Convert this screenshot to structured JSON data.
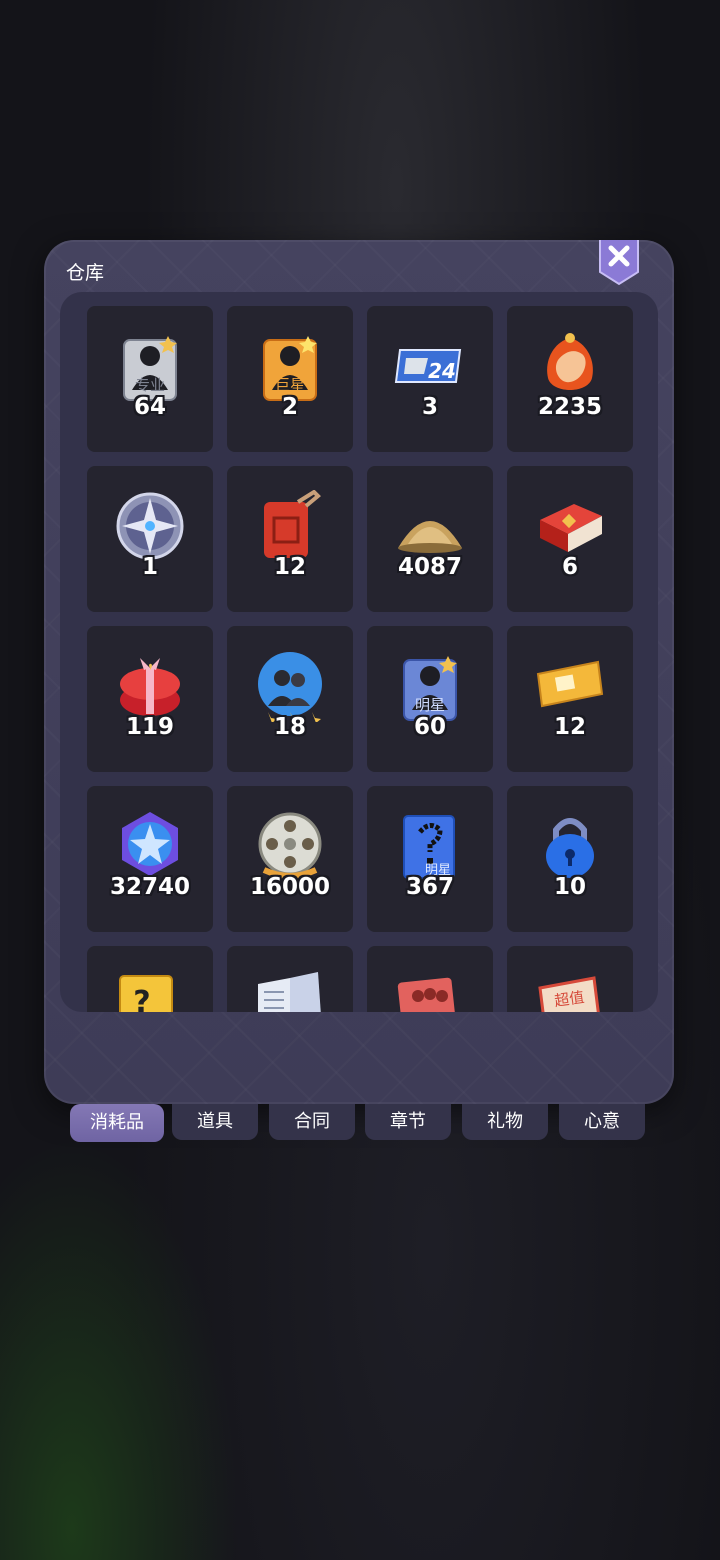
{
  "panel": {
    "title": "仓库"
  },
  "colors": {
    "panel_bg": "#45435f",
    "cell_bg": "#25242f",
    "tab_active": "#7a6fae",
    "close_badge": "#8b7ad6"
  },
  "items": [
    {
      "name": "pro-card-icon",
      "count": "64",
      "label": "专业"
    },
    {
      "name": "superstar-card-icon",
      "count": "2",
      "label": "巨星"
    },
    {
      "name": "speed-24-ticket-icon",
      "count": "3"
    },
    {
      "name": "thumbs-up-icon",
      "count": "2235"
    },
    {
      "name": "compass-star-icon",
      "count": "1"
    },
    {
      "name": "fuel-can-icon",
      "count": "12"
    },
    {
      "name": "sand-pile-icon",
      "count": "4087"
    },
    {
      "name": "red-book-icon",
      "count": "6"
    },
    {
      "name": "gift-box-icon",
      "count": "119"
    },
    {
      "name": "staff-badge-icon",
      "count": "18"
    },
    {
      "name": "star-card-icon",
      "count": "60",
      "label": "明星"
    },
    {
      "name": "golden-ticket-icon",
      "count": "12"
    },
    {
      "name": "blue-star-medal-icon",
      "count": "32740"
    },
    {
      "name": "film-reel-icon",
      "count": "16000"
    },
    {
      "name": "mystery-star-box-icon",
      "count": "367",
      "label": "明星"
    },
    {
      "name": "blue-lock-icon",
      "count": "10"
    },
    {
      "name": "question-block-icon",
      "count": ""
    },
    {
      "name": "newspaper-icon",
      "count": ""
    },
    {
      "name": "audience-card-icon",
      "count": ""
    },
    {
      "name": "value-ticket-icon",
      "count": "",
      "label": "超值"
    }
  ],
  "tabs": [
    {
      "label": "消耗品",
      "active": true
    },
    {
      "label": "道具"
    },
    {
      "label": "合同"
    },
    {
      "label": "章节"
    },
    {
      "label": "礼物"
    },
    {
      "label": "心意"
    }
  ]
}
